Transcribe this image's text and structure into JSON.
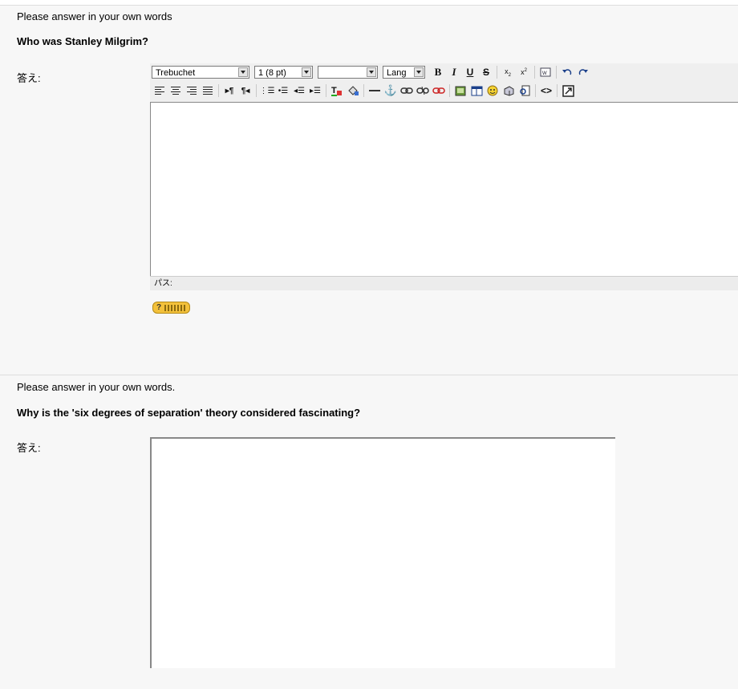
{
  "question1": {
    "instruction": "Please answer in your own words",
    "question": "Who was Stanley Milgrim?",
    "answer_label": "答え:",
    "editor": {
      "font_select": "Trebuchet",
      "size_select": "1 (8 pt)",
      "format_select": "",
      "lang_select": "Lang",
      "bold_label": "B",
      "italic_label": "I",
      "underline_label": "U",
      "strike_label": "S",
      "path_label": "パス:",
      "content": ""
    }
  },
  "question2": {
    "instruction": "Please answer in your own words.",
    "question": "Why is the 'six degrees of separation' theory considered fascinating?",
    "answer_label": "答え:",
    "content": ""
  }
}
